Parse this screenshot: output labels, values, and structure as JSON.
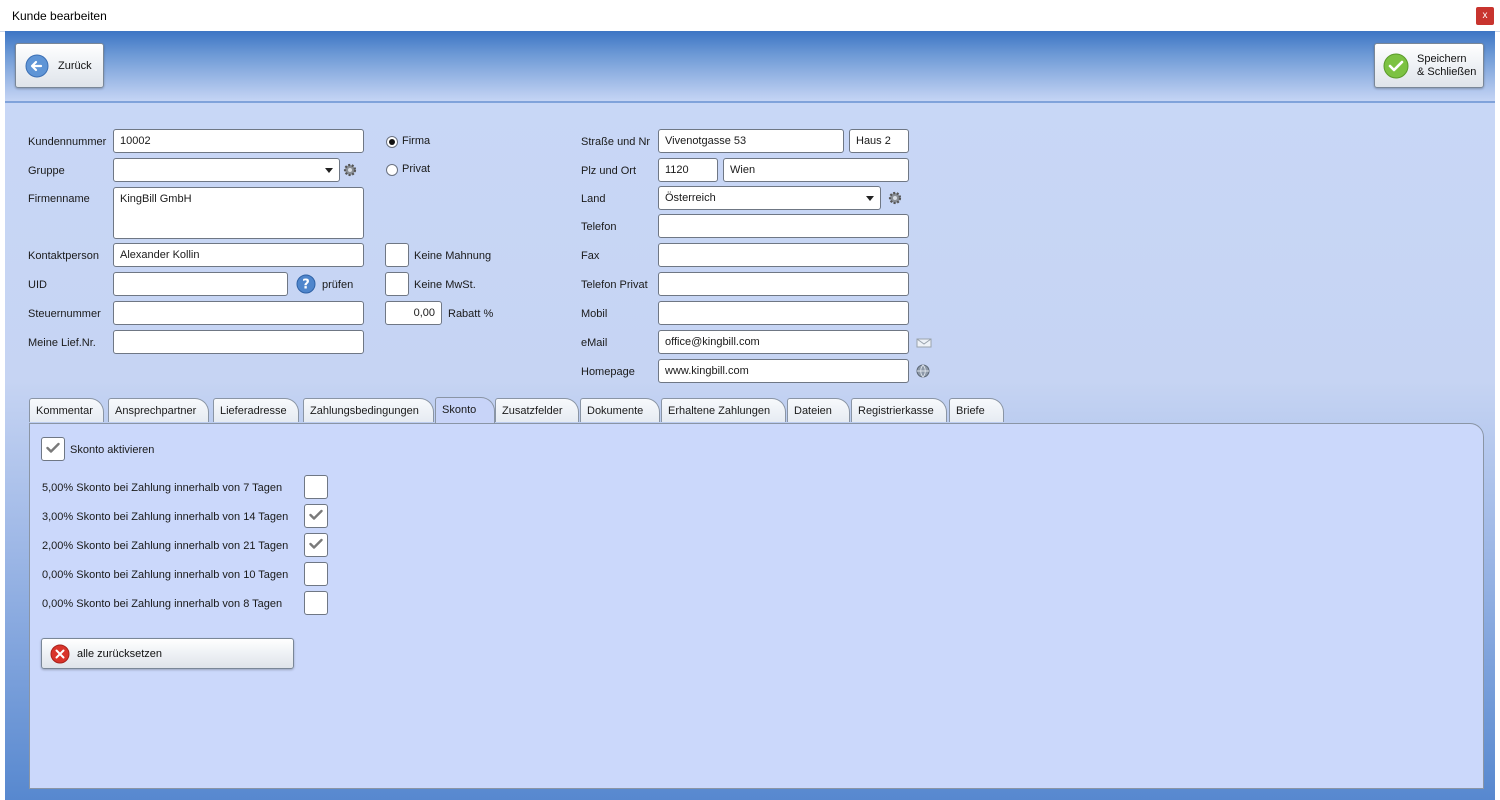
{
  "window": {
    "title": "Kunde bearbeiten",
    "close_glyph": "x"
  },
  "toolbar": {
    "back_label": "Zurück",
    "save_line1": "Speichern",
    "save_line2": "& Schließen"
  },
  "form": {
    "kundennummer": {
      "label": "Kundennummer",
      "value": "10002"
    },
    "gruppe": {
      "label": "Gruppe",
      "value": ""
    },
    "firmenname": {
      "label": "Firmenname",
      "value": "KingBill GmbH"
    },
    "kontaktperson": {
      "label": "Kontaktperson",
      "value": "Alexander Kollin"
    },
    "uid": {
      "label": "UID",
      "value": "",
      "check_label": "prüfen"
    },
    "steuernummer": {
      "label": "Steuernummer",
      "value": ""
    },
    "lief_nr": {
      "label": "Meine Lief.Nr.",
      "value": ""
    },
    "type_firma": "Firma",
    "type_privat": "Privat",
    "keine_mahnung": "Keine Mahnung",
    "keine_mwst": "Keine MwSt.",
    "rabatt": {
      "value": "0,00",
      "label": "Rabatt %"
    },
    "strasse": {
      "label": "Straße und Nr",
      "value": "Vivenotgasse 53",
      "haus": "Haus 2"
    },
    "plz_ort": {
      "label": "Plz und Ort",
      "plz": "1120",
      "ort": "Wien"
    },
    "land": {
      "label": "Land",
      "value": "Österreich"
    },
    "telefon": {
      "label": "Telefon",
      "value": ""
    },
    "fax": {
      "label": "Fax",
      "value": ""
    },
    "telefon_privat": {
      "label": "Telefon Privat",
      "value": ""
    },
    "mobil": {
      "label": "Mobil",
      "value": ""
    },
    "email": {
      "label": "eMail",
      "value": "office@kingbill.com"
    },
    "homepage": {
      "label": "Homepage",
      "value": "www.kingbill.com"
    }
  },
  "tabs": [
    "Kommentar",
    "Ansprechpartner",
    "Lieferadresse",
    "Zahlungsbedingungen",
    "Skonto",
    "Zusatzfelder",
    "Dokumente",
    "Erhaltene Zahlungen",
    "Dateien",
    "Registrierkasse",
    "Briefe"
  ],
  "active_tab": "Skonto",
  "skonto": {
    "activate_label": "Skonto aktivieren",
    "activated": true,
    "rows": [
      {
        "label": "5,00% Skonto bei Zahlung innerhalb von 7 Tagen",
        "checked": false
      },
      {
        "label": "3,00% Skonto bei Zahlung innerhalb von 14 Tagen",
        "checked": true
      },
      {
        "label": "2,00% Skonto bei Zahlung innerhalb von 21 Tagen",
        "checked": true
      },
      {
        "label": "0,00% Skonto bei Zahlung innerhalb von 10 Tagen",
        "checked": false
      },
      {
        "label": "0,00% Skonto bei Zahlung innerhalb von 8 Tagen",
        "checked": false
      }
    ],
    "reset_label": "alle zurücksetzen"
  },
  "colors": {
    "accent": "#3d75c4",
    "panel": "#cbd8fb",
    "check": "#7a7a7a",
    "reset_icon": "#d9342b",
    "save_icon": "#7cc242",
    "back_icon": "#5f95d6"
  }
}
